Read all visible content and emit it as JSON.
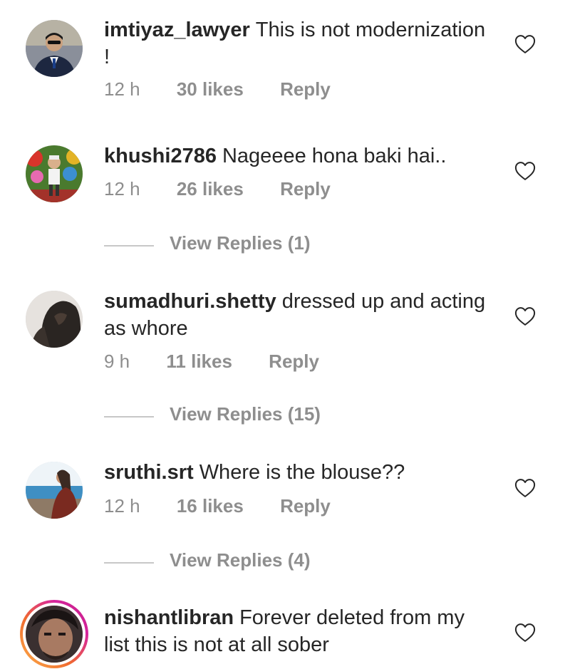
{
  "comments": [
    {
      "username": "imtiyaz_lawyer",
      "text": "This is not modernization !",
      "time": "12 h",
      "likes": "30 likes",
      "reply": "Reply",
      "avatar_icon": "avatar-man-suit"
    },
    {
      "username": "khushi2786",
      "text": "Nageeee hona baki hai..",
      "time": "12 h",
      "likes": "26 likes",
      "reply": "Reply",
      "avatar_icon": "avatar-child-toys"
    },
    {
      "username": "sumadhuri.shetty",
      "text": "dressed up and acting as whore",
      "time": "9 h",
      "likes": "11 likes",
      "reply": "Reply",
      "avatar_icon": "avatar-woman-hair"
    },
    {
      "username": "sruthi.srt",
      "text": "Where is the blouse??",
      "time": "12 h",
      "likes": "16 likes",
      "reply": "Reply",
      "avatar_icon": "avatar-woman-beach"
    },
    {
      "username": "nishantlibran",
      "text": "Forever deleted from my list this is not at all sober",
      "avatar_icon": "avatar-man-story-ring"
    }
  ],
  "view_replies": [
    {
      "label": "View Replies (1)"
    },
    {
      "label": "View Replies (15)"
    },
    {
      "label": "View Replies (4)"
    }
  ],
  "colors": {
    "text": "#262626",
    "secondary": "#8e8e8e",
    "divider": "#c7c7c7",
    "story_ring": [
      "#fdb24a",
      "#d6249f"
    ]
  },
  "icons": {
    "like": "heart-outline-icon"
  }
}
